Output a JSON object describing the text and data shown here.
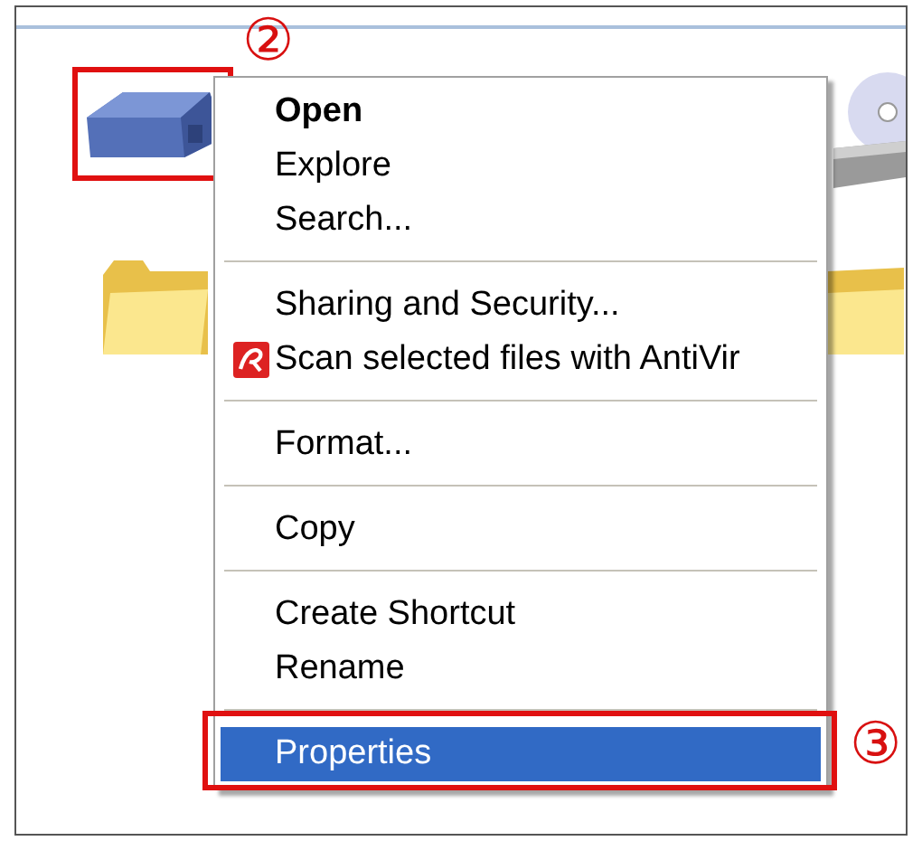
{
  "menu": {
    "items": [
      {
        "kind": "item",
        "label": "Open",
        "default": true,
        "selected": false
      },
      {
        "kind": "item",
        "label": "Explore",
        "default": false,
        "selected": false
      },
      {
        "kind": "item",
        "label": "Search...",
        "default": false,
        "selected": false
      },
      {
        "kind": "separator"
      },
      {
        "kind": "item",
        "label": "Sharing and Security...",
        "default": false,
        "selected": false
      },
      {
        "kind": "item",
        "label": "Scan selected files with AntiVir",
        "default": false,
        "selected": false,
        "icon": true
      },
      {
        "kind": "separator"
      },
      {
        "kind": "item",
        "label": "Format...",
        "default": false,
        "selected": false
      },
      {
        "kind": "separator"
      },
      {
        "kind": "item",
        "label": "Copy",
        "default": false,
        "selected": false
      },
      {
        "kind": "separator"
      },
      {
        "kind": "item",
        "label": "Create Shortcut",
        "default": false,
        "selected": false
      },
      {
        "kind": "item",
        "label": "Rename",
        "default": false,
        "selected": false
      },
      {
        "kind": "separator"
      },
      {
        "kind": "item",
        "label": "Properties",
        "default": false,
        "selected": true
      }
    ]
  },
  "callouts": [
    {
      "label": "②"
    },
    {
      "label": "③"
    }
  ]
}
